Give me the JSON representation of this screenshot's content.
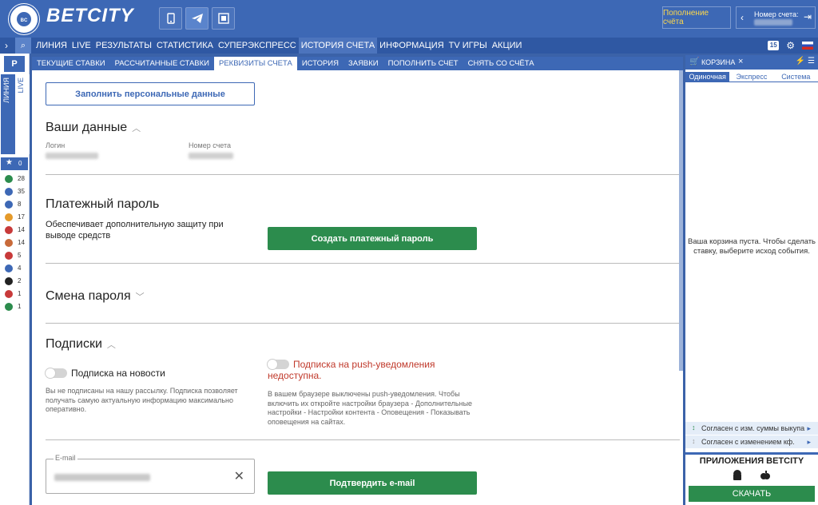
{
  "header": {
    "brand": "BETCITY",
    "topup_label": "Пополнение счёта",
    "account_label": "Номер счета:"
  },
  "nav": {
    "items": [
      "ЛИНИЯ",
      "LIVE",
      "РЕЗУЛЬТАТЫ",
      "СТАТИСТИКА",
      "СУПЕРЭКСПРЕСС",
      "ИСТОРИЯ СЧЕТА",
      "ИНФОРМАЦИЯ",
      "TV ИГРЫ",
      "АКЦИИ"
    ],
    "active": "ИСТОРИЯ СЧЕТА",
    "badge": "15"
  },
  "left_sidebar": {
    "p_label": "P",
    "tab_line": "ЛИНИЯ",
    "tab_live": "LIVE",
    "fav_count": "0",
    "sports": [
      {
        "icon": "soccer-icon",
        "count": "28",
        "color": "#2c8c4d"
      },
      {
        "icon": "tennis-icon",
        "count": "35",
        "color": "#3d68b5"
      },
      {
        "icon": "hockey-icon",
        "count": "8",
        "color": "#3d68b5"
      },
      {
        "icon": "basketball-icon",
        "count": "17",
        "color": "#e59a2a"
      },
      {
        "icon": "table-tennis-icon",
        "count": "14",
        "color": "#c83a3a"
      },
      {
        "icon": "volleyball-icon",
        "count": "14",
        "color": "#c86a3a"
      },
      {
        "icon": "esports-icon",
        "count": "5",
        "color": "#c83a3a"
      },
      {
        "icon": "badminton-icon",
        "count": "4",
        "color": "#3d68b5"
      },
      {
        "icon": "billiards-icon",
        "count": "2",
        "color": "#222222"
      },
      {
        "icon": "darts-icon",
        "count": "1",
        "color": "#c83a3a"
      },
      {
        "icon": "cricket-icon",
        "count": "1",
        "color": "#2c8c4d"
      }
    ]
  },
  "subnav": {
    "items": [
      "ТЕКУЩИЕ СТАВКИ",
      "РАССЧИТАННЫЕ СТАВКИ",
      "РЕКВИЗИТЫ СЧЕТА",
      "ИСТОРИЯ",
      "ЗАЯВКИ",
      "ПОПОЛНИТЬ СЧЕТ",
      "СНЯТЬ СО СЧЁТА"
    ],
    "active": "РЕКВИЗИТЫ СЧЕТА"
  },
  "main": {
    "fill_button": "Заполнить персональные данные",
    "your_data_title": "Ваши данные",
    "login_label": "Логин",
    "account_number_label": "Номер счета",
    "payment_password_title": "Платежный пароль",
    "payment_password_desc": "Обеспечивает дополнительную защиту при выводе средств",
    "create_password_button": "Создать платежный пароль",
    "change_password_title": "Смена пароля",
    "subscriptions_title": "Подписки",
    "news_sub_label": "Подписка на новости",
    "news_sub_desc": "Вы не подписаны на нашу рассылку. Подписка позволяет получать самую актуальную информацию максимально оперативно.",
    "push_sub_label": "Подписка на push-уведомления недоступна.",
    "push_sub_desc": "В вашем браузере выключены push-уведомления. Чтобы включить их откройте настройки браузера - Дополнительные настройки - Настройки контента - Оповещения - Показывать оповещения на сайтах.",
    "email_label": "E-mail",
    "confirm_email_button": "Подтвердить e-mail",
    "accent_color": "#2c8c4d",
    "warning_color": "#c0392b"
  },
  "cart": {
    "title": "КОРЗИНА",
    "tabs": [
      "Одиночная",
      "Экспресс",
      "Система"
    ],
    "active_tab": "Одиночная",
    "empty_text": "Ваша корзина пуста. Чтобы сделать ставку, выберите исход события.",
    "agree1": "Согласен с изм. суммы выкупа",
    "agree2": "Согласен с изменением кф.",
    "apps_title": "ПРИЛОЖЕНИЯ BETCITY",
    "download": "СКАЧАТЬ"
  }
}
